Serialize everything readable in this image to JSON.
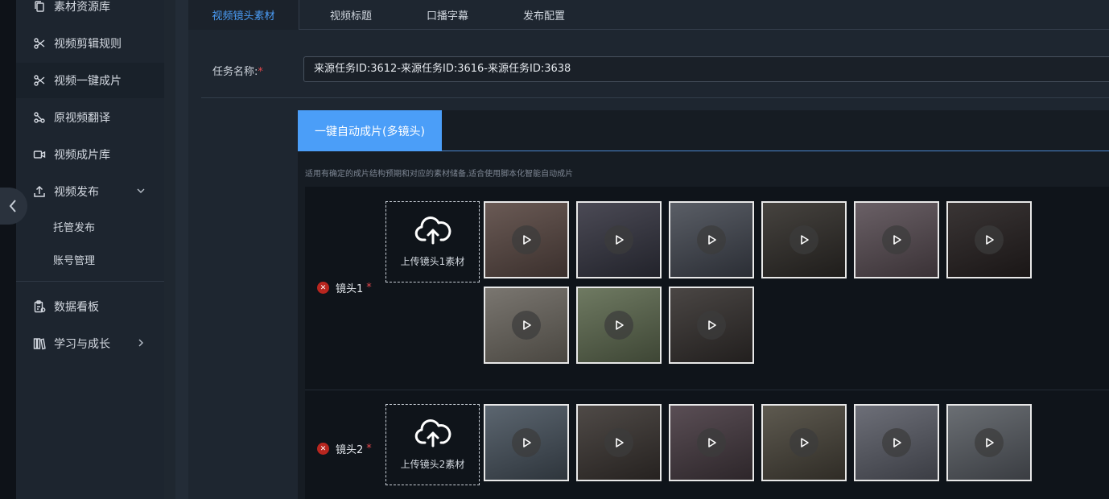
{
  "sidebar": {
    "items": [
      {
        "label": "素材资源库",
        "icon": "copy-icon"
      },
      {
        "label": "视频剪辑规则",
        "icon": "scissors-icon"
      },
      {
        "label": "视频一键成片",
        "icon": "scissors-icon"
      },
      {
        "label": "原视频翻译",
        "icon": "translate-icon"
      },
      {
        "label": "视频成片库",
        "icon": "video-camera-icon"
      },
      {
        "label": "视频发布",
        "icon": "upload-icon",
        "expanded": true
      },
      {
        "label": "数据看板",
        "icon": "clipboard-icon"
      },
      {
        "label": "学习与成长",
        "icon": "books-icon"
      }
    ],
    "sub_items": [
      "托管发布",
      "账号管理"
    ]
  },
  "tabs": [
    "视频镜头素材",
    "视频标题",
    "口播字幕",
    "发布配置"
  ],
  "form": {
    "task_label": "任务名称:",
    "required_mark": "*",
    "task_value": "来源任务ID:3612-来源任务ID:3616-来源任务ID:3638"
  },
  "panel": {
    "tab_label": "一键自动成片(多镜头)",
    "description": "适用有确定的成片结构预期和对应的素材储备,适合使用脚本化智能自动成片"
  },
  "shots": [
    {
      "label": "镜头1",
      "upload_label": "上传镜头1素材",
      "thumb_count": 9
    },
    {
      "label": "镜头2",
      "upload_label": "上传镜头2素材",
      "thumb_count": 6
    }
  ],
  "colors": {
    "accent": "#4b9ef8",
    "required": "#e5484d",
    "remove": "#b8261f"
  }
}
